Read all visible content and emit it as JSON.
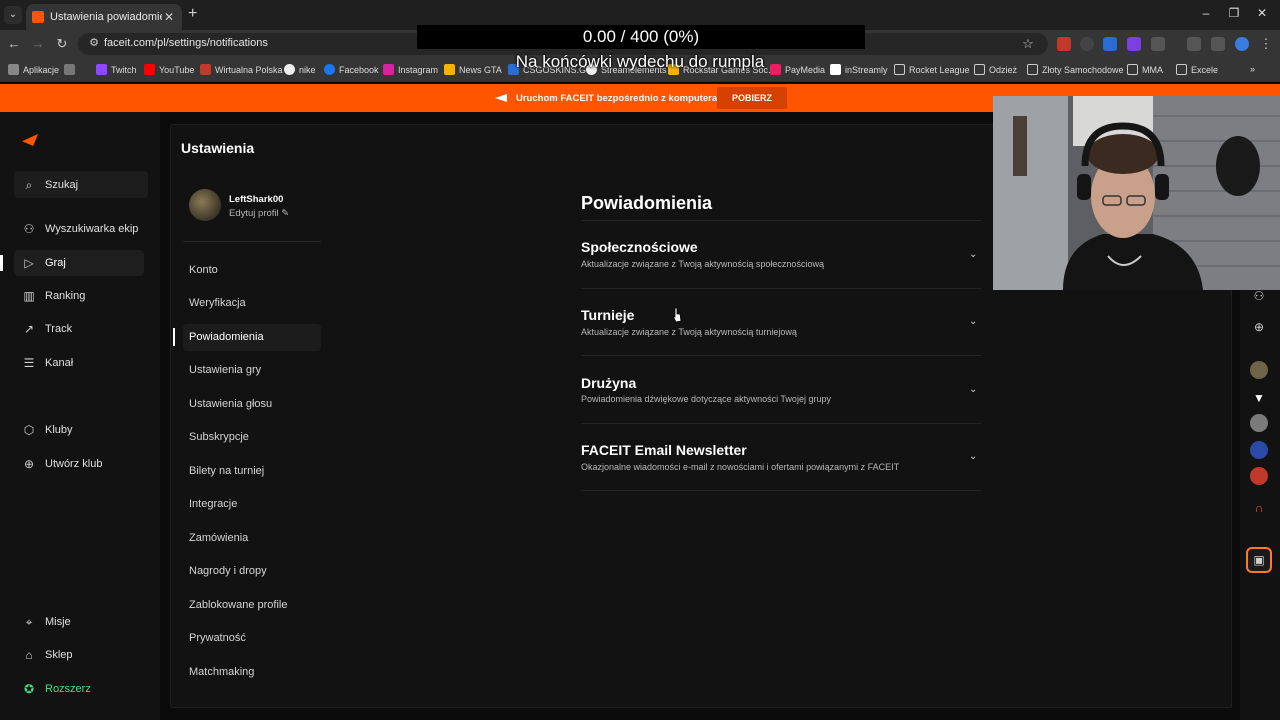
{
  "browser": {
    "tab_title": "Ustawienia powiadomień - FACEIT",
    "tab_close": "✕",
    "url": "faceit.com/pl/settings/notifications",
    "bookmarks": [
      "Aplikacje",
      "Twitch",
      "YouTube",
      "Wirtualna Polska",
      "nike",
      "Facebook",
      "Instagram",
      "News GTA",
      "CSGOSKINS.GG",
      "Streamelements",
      "Rockstar Games Soc...",
      "PayMedia",
      "inStreamly",
      "Rocket League",
      "Odzież",
      "Złoty Samochodowe",
      "MMA",
      "Excele"
    ]
  },
  "overlay": {
    "counter": "0.00 / 400 (0%)",
    "caption": "Na końcówki wydechu do rumpla"
  },
  "promo": {
    "text": "Uruchom FACEIT bezpośrednio z komputera!",
    "button": "POBIERZ"
  },
  "appnav": {
    "search": "Szukaj",
    "items": [
      "Wyszukiwarka ekip",
      "Graj",
      "Ranking",
      "Track",
      "Kanał"
    ],
    "clubs": [
      "Kluby",
      "Utwórz klub"
    ],
    "bottom": [
      "Misje",
      "Sklep",
      "Rozszerz"
    ]
  },
  "settings": {
    "title": "Ustawienia",
    "user_name": "LeftShark00",
    "edit_profile": "Edytuj profil",
    "menu": [
      "Konto",
      "Weryfikacja",
      "Powiadomienia",
      "Ustawienia gry",
      "Ustawienia głosu",
      "Subskrypcje",
      "Bilety na turniej",
      "Integracje",
      "Zamówienia",
      "Nagrody i dropy",
      "Zablokowane profile",
      "Prywatność",
      "Matchmaking"
    ]
  },
  "notifications": {
    "title": "Powiadomienia",
    "sections": [
      {
        "title": "Społecznościowe",
        "subtitle": "Aktualizacje związane z Twoją aktywnością społecznościową"
      },
      {
        "title": "Turnieje",
        "subtitle": "Aktualizacje związane z Twoją aktywnością turniejową"
      },
      {
        "title": "Drużyna",
        "subtitle": "Powiadomienia dźwiękowe dotyczące aktywności Twojej grupy"
      },
      {
        "title": "FACEIT Email Newsletter",
        "subtitle": "Okazjonalne wiadomości e-mail z nowościami i ofertami powiązanymi z FACEIT"
      }
    ]
  },
  "colors": {
    "accent": "#ff5500",
    "background": "#0b0b0b",
    "panel": "#121212"
  }
}
